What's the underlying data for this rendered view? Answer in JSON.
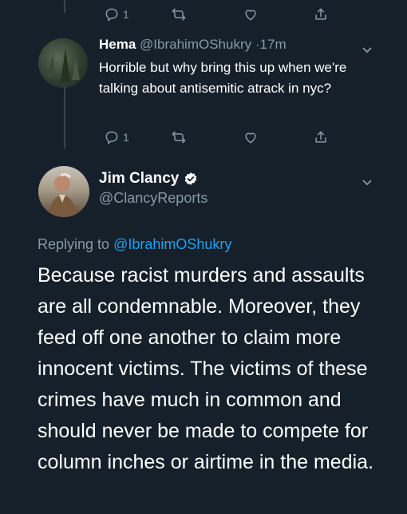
{
  "colors": {
    "background": "#15202b",
    "muted": "#8899a6",
    "link": "#1da1f2"
  },
  "top_actions": {
    "reply_count": "1"
  },
  "reply_tweet": {
    "name": "Hema",
    "handle": "@IbrahimOShukry",
    "separator": "·",
    "time": "17m",
    "text": "Horrible but why bring this up when we're talking about antisemitic atrack in nyc?",
    "reply_count": "1"
  },
  "main_tweet": {
    "name": "Jim Clancy",
    "handle": "@ClancyReports",
    "replying_prefix": "Replying to",
    "replying_to": "@IbrahimOShukry",
    "text": "Because racist murders and assaults are all condemnable.  Moreover, they feed off one another to claim more innocent victims.  The victims of these crimes have much in common and should never be made to compete for column inches or airtime in the media."
  },
  "icons": [
    "reply-icon",
    "retweet-icon",
    "like-icon",
    "share-icon",
    "chevron-down-icon",
    "verified-badge-icon"
  ]
}
